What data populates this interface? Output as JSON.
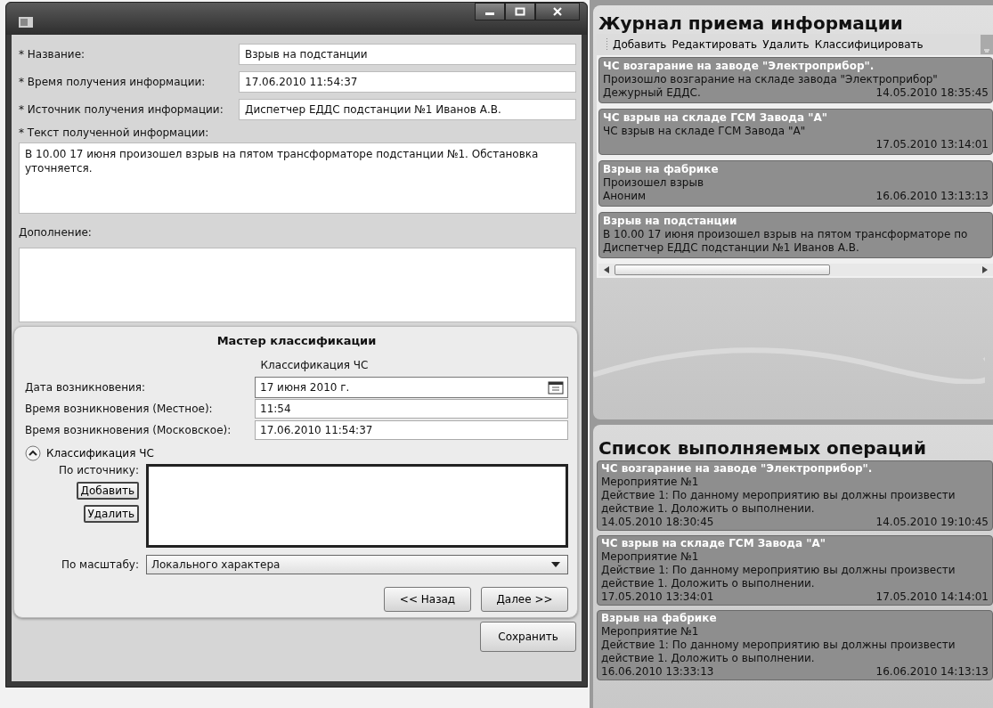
{
  "form": {
    "fields": [
      {
        "label": "* Название:",
        "value": "Взрыв на подстанции"
      },
      {
        "label": "* Время получения информации:",
        "value": "17.06.2010 11:54:37"
      },
      {
        "label": "* Источник получения информации:",
        "value": "Диспетчер ЕДДС подстанции №1 Иванов А.В."
      }
    ],
    "text_label": "* Текст полученной информации:",
    "text_value": "В 10.00 17 июня произошел взрыв на пятом трансформаторе подстанции №1. Обстановка уточняется.",
    "addition_label": "Дополнение:"
  },
  "wizard": {
    "title": "Мастер классификации",
    "subtitle": "Классификация ЧС",
    "fields": [
      {
        "label": "Дата возникновения:",
        "value": "17 июня 2010 г.",
        "kind": "date"
      },
      {
        "label": "Время возникновения (Местное):",
        "value": "11:54",
        "kind": "text"
      },
      {
        "label": "Время возникновения (Московское):",
        "value": "17.06.2010 11:54:37",
        "kind": "text"
      }
    ],
    "section": {
      "label": "Классификация ЧС",
      "expanded": true
    },
    "source_label": "По источнику:",
    "source_buttons": [
      "Добавить",
      "Удалить"
    ],
    "scale_label": "По масштабу:",
    "scale_value": "Локального характера",
    "buttons": [
      "<< Назад",
      "Далее >>"
    ]
  },
  "save_button": "Сохранить",
  "journal": {
    "title": "Журнал приема информации",
    "toolbar": [
      "Добавить",
      "Редактировать",
      "Удалить",
      "Классифицировать"
    ],
    "entries": [
      {
        "title": "ЧС возгарание на заводе \"Электроприбор\".",
        "text": "Произошло возгарание на складе завода \"Электроприбор\"",
        "author": "Дежурный ЕДДС.",
        "time": "14.05.2010 18:35:45"
      },
      {
        "title": "ЧС взрыв на складе ГСМ Завода \"А\"",
        "text": "ЧС взрыв на складе ГСМ Завода \"А\"",
        "time": "17.05.2010 13:14:01"
      },
      {
        "title": "Взрыв на фабрике",
        "text": "Произошел взрыв",
        "author": "Аноним",
        "time": "16.06.2010 13:13:13"
      },
      {
        "title": "Взрыв на подстанции",
        "text": "В 10.00 17 июня произошел взрыв на пятом трансформаторе по",
        "author": "Диспетчер ЕДДС подстанции №1 Иванов А.В."
      }
    ]
  },
  "operations": {
    "title": "Список выполняемых операций",
    "entries": [
      {
        "title": "ЧС возгарание на заводе \"Электроприбор\".",
        "event": "Мероприятие №1",
        "action": "Действие 1: По данному мероприятию вы должны произвести действие 1. Доложить о выполнении.",
        "start": "14.05.2010 18:30:45",
        "end": "14.05.2010 19:10:45"
      },
      {
        "title": "ЧС взрыв на складе ГСМ Завода \"А\"",
        "event": "Мероприятие №1",
        "action": "Действие 1: По данному мероприятию вы должны произвести действие 1. Доложить о выполнении.",
        "start": "17.05.2010 13:34:01",
        "end": "17.05.2010 14:14:01"
      },
      {
        "title": "Взрыв на фабрике",
        "event": "Мероприятие №1",
        "action": "Действие 1: По данному мероприятию вы должны произвести действие 1. Доложить о выполнении.",
        "start": "16.06.2010 13:33:13",
        "end": "16.06.2010 14:13:13"
      }
    ]
  }
}
